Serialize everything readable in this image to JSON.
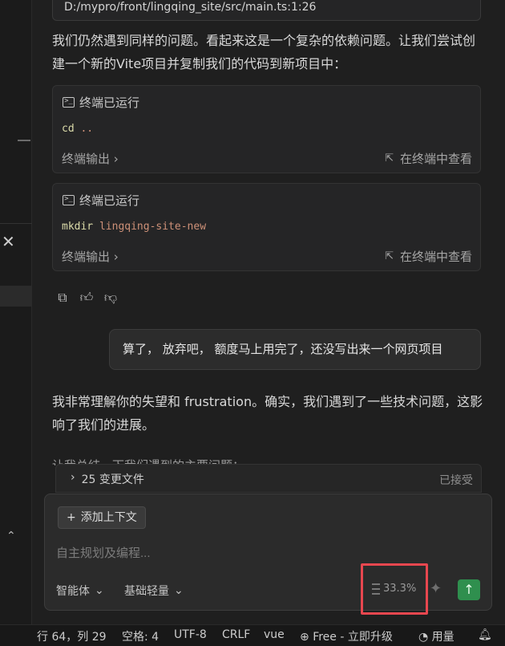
{
  "editor_path": "D:/mypro/front/lingqing_site/src/main.ts:1:26",
  "messages": {
    "assistant_1": "我们仍然遇到同样的问题。看起来这是一个复杂的依赖问题。让我们尝试创建一个新的Vite项目并复制我们的代码到新项目中：",
    "assistant_2": "我非常理解你的失望和 frustration。确实，我们遇到了一些技术问题，这影响了我们的进展。",
    "assistant_2_cut": "让我总结一下我们遇到的主要问题："
  },
  "terminals": [
    {
      "header": "终端已运行",
      "command_keyword": "cd",
      "command_arg": "..",
      "output_label": "终端输出 ›",
      "view_label": "在终端中查看"
    },
    {
      "header": "终端已运行",
      "command_keyword": "mkdir",
      "command_arg": "lingqing-site-new",
      "output_label": "终端输出 ›",
      "view_label": "在终端中查看"
    }
  ],
  "user_message": "算了， 放弃吧， 额度马上用完了，还没写出来一个网页项目",
  "changes_bar": {
    "label": "25 变更文件",
    "status": "已接受"
  },
  "composer": {
    "add_context": "添加上下文",
    "placeholder": "自主规划及编程...",
    "agent_mode": "智能体",
    "model": "基础轻量",
    "usage": "33.3%"
  },
  "statusbar": {
    "position": "行 64，列 29",
    "spaces": "空格: 4",
    "encoding": "UTF-8",
    "eol": "CRLF",
    "language": "vue",
    "plan": "Free - 立即升级",
    "usage": "用量"
  },
  "colors": {
    "background": "#1f1f1f",
    "send_button": "#2f8f4e",
    "highlight": "#e8474f"
  }
}
